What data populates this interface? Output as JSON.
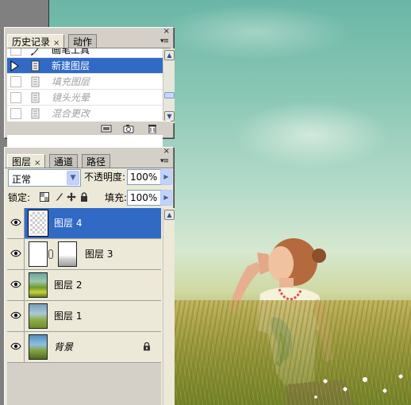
{
  "history_panel": {
    "tabs": [
      {
        "label": "历史记录",
        "active": true,
        "close": "×"
      },
      {
        "label": "动作",
        "active": false
      }
    ],
    "close_glyph": "×",
    "menu_glyph": "▾≡",
    "items": [
      {
        "label": "画笔工具",
        "state": "done",
        "icon": "brush-icon"
      },
      {
        "label": "新建图层",
        "state": "selected",
        "icon": "history-step-icon"
      },
      {
        "label": "填充图层",
        "state": "undone",
        "icon": "history-step-icon"
      },
      {
        "label": "镜头光晕",
        "state": "undone",
        "icon": "history-step-icon"
      },
      {
        "label": "混合更改",
        "state": "undone",
        "icon": "history-step-icon"
      }
    ],
    "footer_icons": [
      "new-document-from-state-icon",
      "new-snapshot-icon",
      "delete-icon"
    ]
  },
  "layers_panel": {
    "tabs": [
      {
        "label": "图层",
        "active": true,
        "close": "×"
      },
      {
        "label": "通道",
        "active": false
      },
      {
        "label": "路径",
        "active": false
      }
    ],
    "close_glyph": "×",
    "menu_glyph": "▾≡",
    "blend_mode": "正常",
    "opacity_label": "不透明度:",
    "opacity_value": "100%",
    "lock_label": "锁定:",
    "fill_label": "填充:",
    "fill_value": "100%",
    "lock_icons": [
      "lock-transparency-icon",
      "lock-image-icon",
      "lock-position-icon",
      "lock-all-icon"
    ],
    "layers": [
      {
        "name": "图层 4",
        "visible": true,
        "selected": true,
        "thumb": "transparent"
      },
      {
        "name": "图层 3",
        "visible": true,
        "selected": false,
        "thumb": "white",
        "has_mask": true
      },
      {
        "name": "图层 2",
        "visible": true,
        "selected": false,
        "thumb": "photo"
      },
      {
        "name": "图层 1",
        "visible": true,
        "selected": false,
        "thumb": "photo"
      },
      {
        "name": "背景",
        "visible": true,
        "selected": false,
        "thumb": "photo",
        "locked": true,
        "italic": true
      }
    ]
  },
  "colors": {
    "selection": "#316ac5",
    "panel_bg": "#d4d0c8",
    "list_bg": "#ece9d8",
    "undone_text": "#a0a0a0"
  }
}
